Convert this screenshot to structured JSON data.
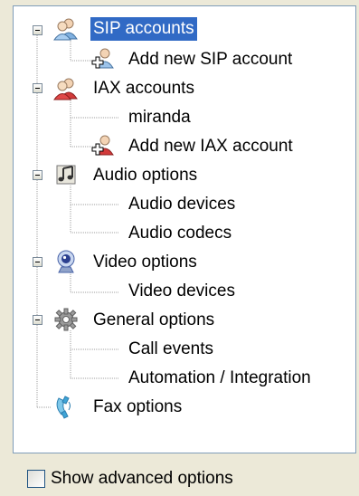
{
  "tree": {
    "sip_accounts": "SIP accounts",
    "add_new_sip_account": "Add new SIP account",
    "iax_accounts": "IAX accounts",
    "miranda": "miranda",
    "add_new_iax_account": "Add new IAX account",
    "audio_options": "Audio options",
    "audio_devices": "Audio devices",
    "audio_codecs": "Audio codecs",
    "video_options": "Video options",
    "video_devices": "Video devices",
    "general_options": "General options",
    "call_events": "Call events",
    "automation_integration": "Automation / Integration",
    "fax_options": "Fax options"
  },
  "footer": {
    "show_advanced_label": "Show advanced options",
    "show_advanced_checked": false
  },
  "colors": {
    "selection": "#316ac5",
    "panel_border": "#7f9db9",
    "dialog_bg": "#ece9d8"
  }
}
